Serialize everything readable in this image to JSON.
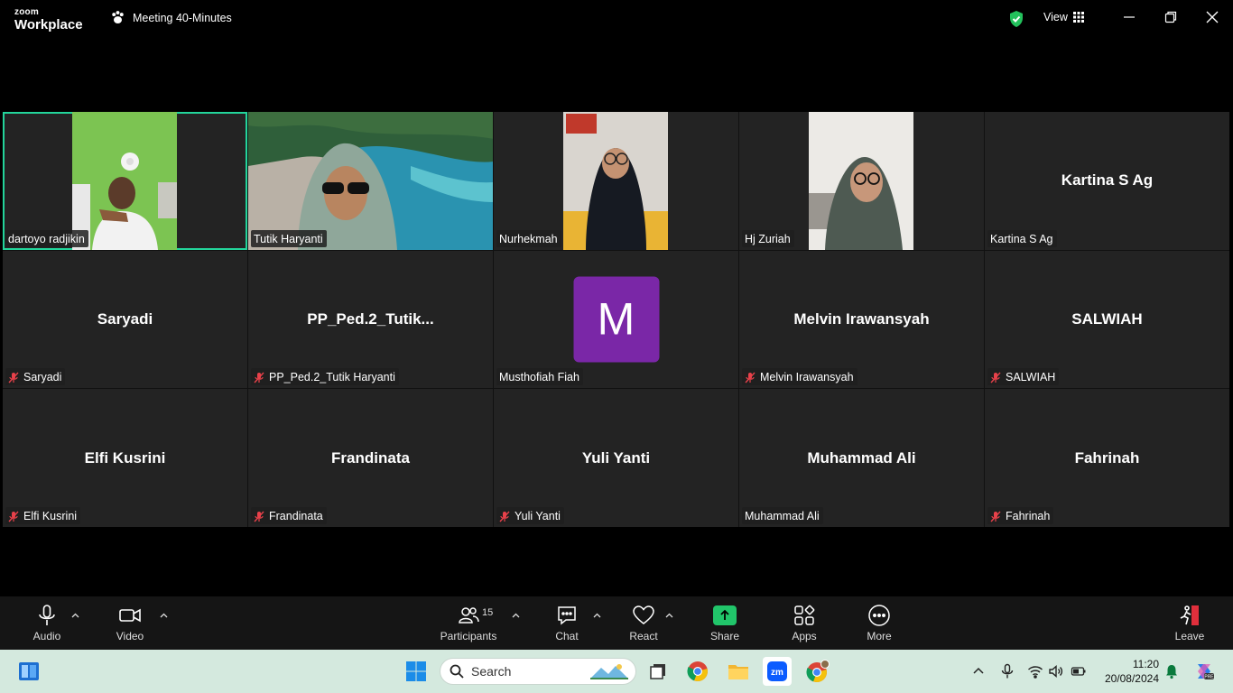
{
  "app": {
    "logo_top": "zoom",
    "logo_bottom": "Workplace",
    "meeting_title": "Meeting 40-Minutes",
    "view_label": "View",
    "accent": "#23d59b"
  },
  "participants": [
    {
      "name": "dartoyo radjikin",
      "video": true,
      "muted": false,
      "active": true
    },
    {
      "name": "Tutik Haryanti",
      "video": true,
      "muted": false
    },
    {
      "name": "Nurhekmah",
      "video": true,
      "muted": false
    },
    {
      "name": "Hj Zuriah",
      "video": true,
      "muted": false
    },
    {
      "name": "Kartina S Ag",
      "display": "Kartina S Ag",
      "video": false,
      "muted": false
    },
    {
      "name": "Saryadi",
      "display": "Saryadi",
      "video": false,
      "muted": true
    },
    {
      "name": "PP_Ped.2_Tutik Haryanti",
      "display": "PP_Ped.2_Tutik...",
      "video": false,
      "muted": true
    },
    {
      "name": "Musthofiah Fiah",
      "avatar_letter": "M",
      "avatar_color": "#7a27a7",
      "video": false,
      "muted": false
    },
    {
      "name": "Melvin Irawansyah",
      "display": "Melvin Irawansyah",
      "video": false,
      "muted": true
    },
    {
      "name": "SALWIAH",
      "display": "SALWIAH",
      "video": false,
      "muted": true
    },
    {
      "name": "Elfi Kusrini",
      "display": "Elfi Kusrini",
      "video": false,
      "muted": true
    },
    {
      "name": "Frandinata",
      "display": "Frandinata",
      "video": false,
      "muted": true
    },
    {
      "name": "Yuli Yanti",
      "display": "Yuli Yanti",
      "video": false,
      "muted": true
    },
    {
      "name": "Muhammad Ali",
      "display": "Muhammad Ali",
      "video": false,
      "muted": false
    },
    {
      "name": "Fahrinah",
      "display": "Fahrinah",
      "video": false,
      "muted": true
    }
  ],
  "toolbar": {
    "audio": "Audio",
    "video": "Video",
    "participants": "Participants",
    "participants_count": "15",
    "chat": "Chat",
    "react": "React",
    "share": "Share",
    "apps": "Apps",
    "more": "More",
    "leave": "Leave"
  },
  "taskbar": {
    "search_placeholder": "Search",
    "time": "11:20",
    "date": "20/08/2024"
  }
}
